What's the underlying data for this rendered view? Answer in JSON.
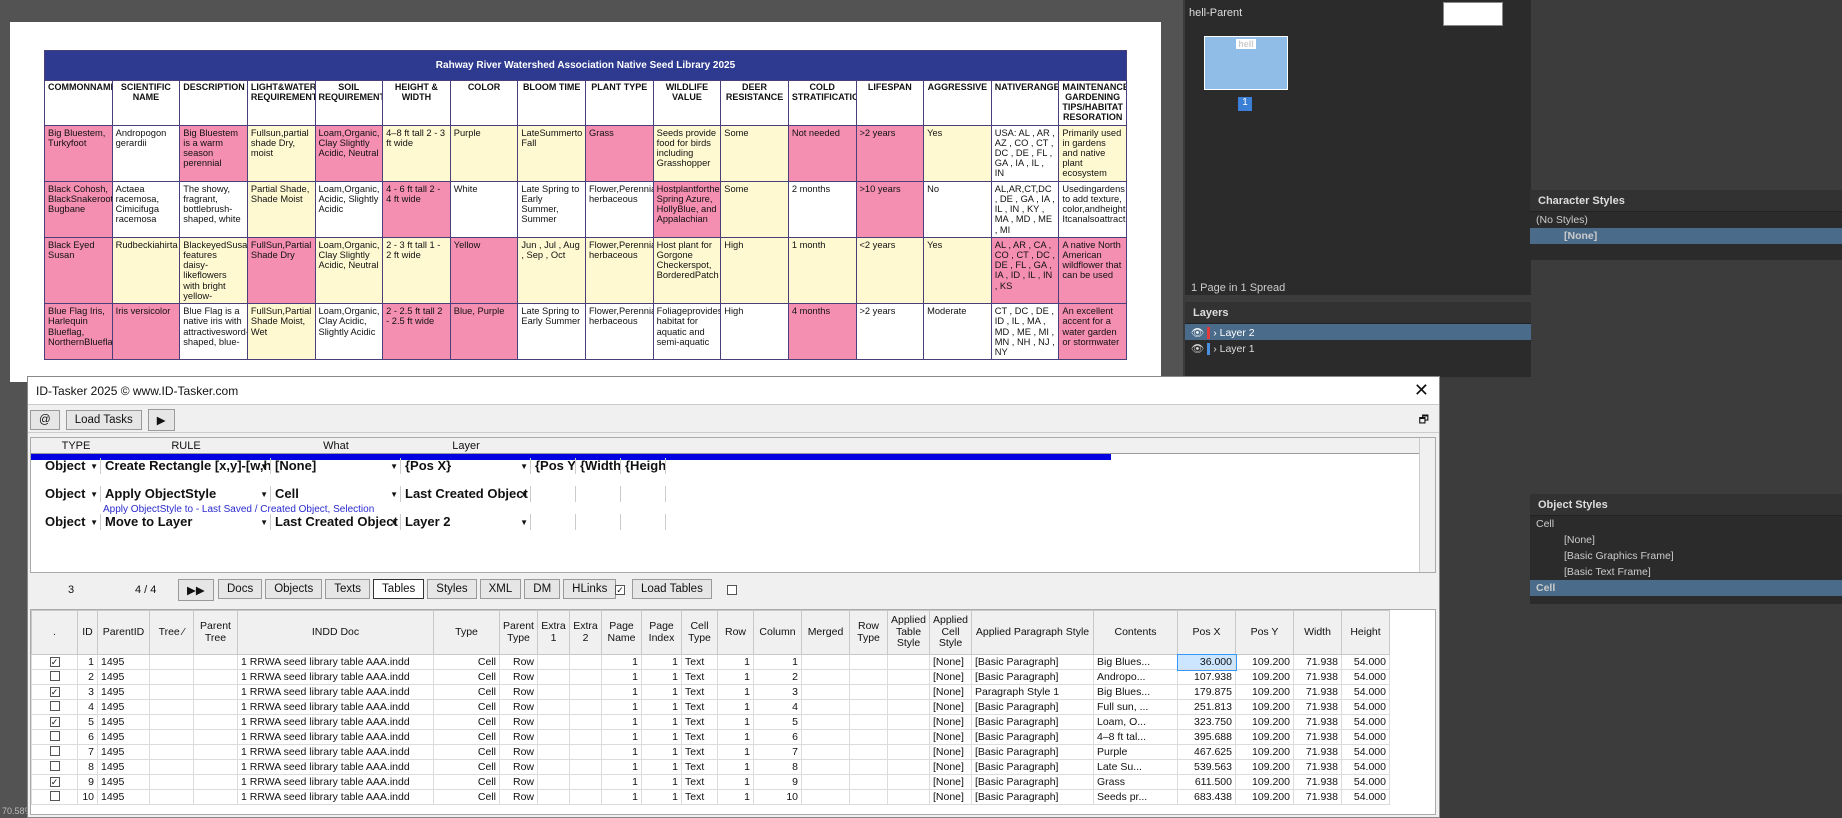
{
  "indesign": {
    "doc_title": "Rahway River Watershed Association Native Seed Library 2025",
    "headers": [
      "COMMONNAME",
      "SCIENTIFIC NAME",
      "DESCRIPTION",
      "LIGHT&WATER REQUIREMENT",
      "SOIL REQUIREMENT",
      "HEIGHT & WIDTH",
      "COLOR",
      "BLOOM TIME",
      "PLANT TYPE",
      "WILDLIFE VALUE",
      "DEER RESISTANCE",
      "COLD STRATIFICATION",
      "LIFESPAN",
      "AGGRESSIVE",
      "NATIVERANGE",
      "MAINTENANCE/ GARDENING TIPS/HABITAT RESORATION"
    ],
    "rows": [
      {
        "cells": [
          "Big Bluestem, Turkyfoot",
          "Andropogon gerardii",
          "Big Bluestem is a warm season perennial",
          "Fullsun,partial shade Dry, moist",
          "Loam,Organic, Clay Slightly Acidic, Neutral",
          "4–8 ft tall 2 - 3 ft wide",
          "Purple",
          "LateSummerto Fall",
          "Grass",
          "Seeds provide food for birds including Grasshopper",
          "Some",
          "Not needed",
          ">2 years",
          "Yes",
          "USA: AL , AR , AZ , CO , CT , DC , DE , FL , GA , IA , IL , IN",
          "Primarily used in gardens and native plant ecosystem"
        ],
        "colors": [
          "cp",
          "cw",
          "cp",
          "cy",
          "cp",
          "cy",
          "cy",
          "cy",
          "cp",
          "cy",
          "cy",
          "cp",
          "cp",
          "cy",
          "cw",
          "cy"
        ]
      },
      {
        "cells": [
          "Black Cohosh, BlackSnakeroot, Bugbane",
          "Actaea racemosa, Cimicifuga racemosa",
          "The showy, fragrant, bottlebrush-shaped, white",
          "Partial Shade, Shade Moist",
          "Loam,Organic, Acidic, Slightly Acidic",
          "4 - 6 ft tall 2 - 4 ft wide",
          "White",
          "Late Spring to Early Summer, Summer",
          "Flower,Perennial herbaceous",
          "Hostplantforthe Spring Azure, HollyBlue, and Appalachian",
          "Some",
          "2 months",
          ">10 years",
          "No",
          "AL,AR,CT,DC , DE , GA , IA , IL , IN , KY , MA , MD , ME , MI",
          "Usedingardens to add texture, color,andheight. Itcanalsoattract"
        ],
        "colors": [
          "cp",
          "cw",
          "cw",
          "cy",
          "cw",
          "cp",
          "cw",
          "cw",
          "cw",
          "cp",
          "cy",
          "cw",
          "cp",
          "cw",
          "cw",
          "cw"
        ]
      },
      {
        "cells": [
          "Black Eyed Susan",
          "Rudbeckiahirta",
          "BlackeyedSusan features daisy-likeflowers with bright yellow-",
          "FullSun,Partial Shade Dry",
          "Loam,Organic, Clay Slightly Acidic, Neutral",
          "2 - 3 ft tall 1 - 2 ft wide",
          "Yellow",
          "Jun , Jul , Aug , Sep , Oct",
          "Flower,Perennial herbaceous",
          "Host plant for Gorgone Checkerspot, BorderedPatch",
          "High",
          "1 month",
          "<2 years",
          "Yes",
          "AL , AR , CA , CO , CT , DC , DE , FL , GA , IA , ID , IL , IN , KS",
          "A native North American wildflower that can be used"
        ],
        "colors": [
          "cp",
          "cy",
          "cy",
          "cp",
          "cy",
          "cy",
          "cp",
          "cy",
          "cy",
          "cy",
          "cy",
          "cy",
          "cy",
          "cy",
          "cp",
          "cp"
        ]
      },
      {
        "cells": [
          "Blue Flag Iris, Harlequin Blueflag, NorthernBlueflag",
          "Iris versicolor",
          "Blue Flag is a native iris with attractivesword-shaped, blue-",
          "FullSun,Partial Shade Moist, Wet",
          "Loam,Organic, Clay Acidic, Slightly Acidic",
          "2 - 2.5 ft tall 2 - 2.5 ft wide",
          "Blue, Purple",
          "Late Spring to Early Summer",
          "Flower,Perennial herbaceous",
          "Foliageprovides habitat for aquatic and semi-aquatic",
          "High",
          "4 months",
          ">2 years",
          "Moderate",
          "CT , DC , DE , ID , IL , MA , MD , ME , MI , MN , NH , NJ , NY",
          "An excellent accent for a water garden or stormwater"
        ],
        "colors": [
          "cp",
          "cp",
          "cw",
          "cy",
          "cw",
          "cp",
          "cp",
          "cw",
          "cw",
          "cw",
          "cw",
          "cp",
          "cw",
          "cw",
          "cw",
          "cp"
        ]
      }
    ],
    "status_left": "70.58%"
  },
  "pages_panel": {
    "parent_label": "hell-Parent",
    "thumb_label": "hell",
    "page_num": "1",
    "spread_info": "1 Page in 1 Spread"
  },
  "layers_panel": {
    "title": "Layers",
    "layers": [
      {
        "name": "Layer 2",
        "color": "#e23b3b"
      },
      {
        "name": "Layer 1",
        "color": "#4a8fe0"
      }
    ]
  },
  "char_styles": {
    "title": "Character Styles",
    "no_styles": "(No Styles)",
    "selected": "[None]"
  },
  "obj_styles": {
    "title": "Object Styles",
    "current": "Cell",
    "items": [
      "[None]",
      "[Basic Graphics Frame]",
      "[Basic Text Frame]",
      "Cell"
    ]
  },
  "tasker": {
    "title": "ID-Tasker 2025  © www.ID-Tasker.com",
    "at_label": "@",
    "load_tasks": "Load Tasks",
    "play": "▶",
    "rule_headers": {
      "type": "TYPE",
      "rule": "RULE",
      "what": "What",
      "layer": "Layer"
    },
    "rules": [
      {
        "type": "Object",
        "rule": "Create Rectangle [x,y]-[w,h]",
        "what": "[None]",
        "layer": "{Pos X}",
        "c5": "{Pos Y}",
        "c6": "{Width}",
        "c7": "{Height}",
        "note": ""
      },
      {
        "type": "Object",
        "rule": "Apply ObjectStyle",
        "what": "Cell",
        "layer": "Last Created Object",
        "c5": "",
        "c6": "",
        "c7": "",
        "note": "Apply ObjectStyle to - Last Saved / Created Object, Selection"
      },
      {
        "type": "Object",
        "rule": "Move to Layer",
        "what": "Last Created Object",
        "layer": "Layer 2",
        "c5": "",
        "c6": "",
        "c7": "",
        "note": ""
      }
    ],
    "counter_left": "3",
    "counter_page": "4 / 4",
    "ff": "▶▶",
    "tabs": [
      "Docs",
      "Objects",
      "Texts",
      "Tables",
      "Styles",
      "XML",
      "DM",
      "HLinks"
    ],
    "active_tab": "Tables",
    "load_tables": "Load Tables",
    "grid_headers": [
      ".",
      "ID",
      "ParentID",
      "Tree ⁄",
      "Parent Tree",
      "INDD Doc",
      "Type",
      "Parent Type",
      "Extra 1",
      "Extra 2",
      "Page Name",
      "Page Index",
      "Cell Type",
      "Row",
      "Column",
      "Merged",
      "Row Type",
      "Applied Table Style",
      "Applied Cell Style",
      "Applied Paragraph Style",
      "Contents",
      "Pos X",
      "Pos Y",
      "Width",
      "Height"
    ],
    "grid_rows": [
      [
        "✓",
        "1",
        "1495",
        "",
        "",
        "1 RRWA seed library table AAA.indd",
        "Cell",
        "Row",
        "",
        "",
        "1",
        "1",
        "Text",
        "1",
        "1",
        "",
        "",
        "",
        "[None]",
        "[Basic Paragraph]",
        "Big Blues...",
        "36.000",
        "109.200",
        "71.938",
        "54.000"
      ],
      [
        "",
        "2",
        "1495",
        "",
        "",
        "1 RRWA seed library table AAA.indd",
        "Cell",
        "Row",
        "",
        "",
        "1",
        "1",
        "Text",
        "1",
        "2",
        "",
        "",
        "",
        "[None]",
        "[Basic Paragraph]",
        "Andropo...",
        "107.938",
        "109.200",
        "71.938",
        "54.000"
      ],
      [
        "✓",
        "3",
        "1495",
        "",
        "",
        "1 RRWA seed library table AAA.indd",
        "Cell",
        "Row",
        "",
        "",
        "1",
        "1",
        "Text",
        "1",
        "3",
        "",
        "",
        "",
        "[None]",
        "Paragraph Style 1",
        "Big Blues...",
        "179.875",
        "109.200",
        "71.938",
        "54.000"
      ],
      [
        "",
        "4",
        "1495",
        "",
        "",
        "1 RRWA seed library table AAA.indd",
        "Cell",
        "Row",
        "",
        "",
        "1",
        "1",
        "Text",
        "1",
        "4",
        "",
        "",
        "",
        "[None]",
        "[Basic Paragraph]",
        "Full sun, ...",
        "251.813",
        "109.200",
        "71.938",
        "54.000"
      ],
      [
        "✓",
        "5",
        "1495",
        "",
        "",
        "1 RRWA seed library table AAA.indd",
        "Cell",
        "Row",
        "",
        "",
        "1",
        "1",
        "Text",
        "1",
        "5",
        "",
        "",
        "",
        "[None]",
        "[Basic Paragraph]",
        "Loam, O...",
        "323.750",
        "109.200",
        "71.938",
        "54.000"
      ],
      [
        "",
        "6",
        "1495",
        "",
        "",
        "1 RRWA seed library table AAA.indd",
        "Cell",
        "Row",
        "",
        "",
        "1",
        "1",
        "Text",
        "1",
        "6",
        "",
        "",
        "",
        "[None]",
        "[Basic Paragraph]",
        "4–8 ft tal...",
        "395.688",
        "109.200",
        "71.938",
        "54.000"
      ],
      [
        "",
        "7",
        "1495",
        "",
        "",
        "1 RRWA seed library table AAA.indd",
        "Cell",
        "Row",
        "",
        "",
        "1",
        "1",
        "Text",
        "1",
        "7",
        "",
        "",
        "",
        "[None]",
        "[Basic Paragraph]",
        "Purple",
        "467.625",
        "109.200",
        "71.938",
        "54.000"
      ],
      [
        "",
        "8",
        "1495",
        "",
        "",
        "1 RRWA seed library table AAA.indd",
        "Cell",
        "Row",
        "",
        "",
        "1",
        "1",
        "Text",
        "1",
        "8",
        "",
        "",
        "",
        "[None]",
        "[Basic Paragraph]",
        "Late Su...",
        "539.563",
        "109.200",
        "71.938",
        "54.000"
      ],
      [
        "✓",
        "9",
        "1495",
        "",
        "",
        "1 RRWA seed library table AAA.indd",
        "Cell",
        "Row",
        "",
        "",
        "1",
        "1",
        "Text",
        "1",
        "9",
        "",
        "",
        "",
        "[None]",
        "[Basic Paragraph]",
        "Grass",
        "611.500",
        "109.200",
        "71.938",
        "54.000"
      ],
      [
        "",
        "10",
        "1495",
        "",
        "",
        "1 RRWA seed library table AAA.indd",
        "Cell",
        "Row",
        "",
        "",
        "1",
        "1",
        "Text",
        "1",
        "10",
        "",
        "",
        "",
        "[None]",
        "[Basic Paragraph]",
        "Seeds pr...",
        "683.438",
        "109.200",
        "71.938",
        "54.000"
      ]
    ]
  }
}
